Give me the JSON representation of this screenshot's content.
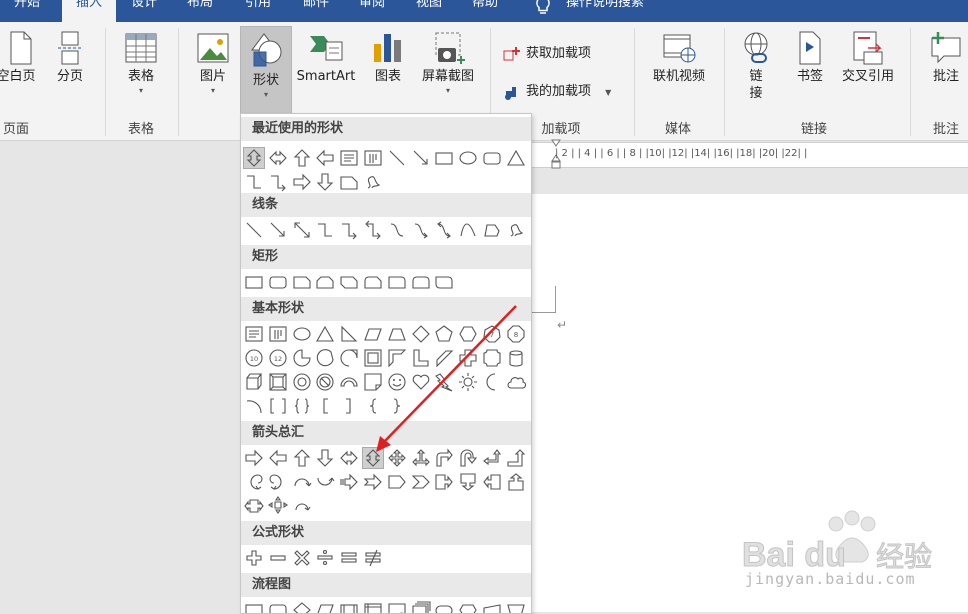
{
  "tabs": [
    "开始",
    "插入",
    "设计",
    "布局",
    "引用",
    "邮件",
    "审阅",
    "视图",
    "帮助",
    "操作说明搜索"
  ],
  "active_tab": "插入",
  "ribbon": {
    "pages": {
      "blank_page": "空白页",
      "page_break": "分页",
      "group": "页面"
    },
    "tables": {
      "table": "表格",
      "group": "表格"
    },
    "illustrations": {
      "pictures": "图片",
      "shapes": "形状",
      "smartart": "SmartArt",
      "chart": "图表",
      "screenshot": "屏幕截图"
    },
    "addins": {
      "get": "获取加载项",
      "my": "我的加载项",
      "group": "加载项"
    },
    "media": {
      "online_video": "联机视频",
      "group": "媒体"
    },
    "links": {
      "link": "链\n接",
      "bookmark": "书签",
      "cross_ref": "交叉引用",
      "group": "链接"
    },
    "comments": {
      "comment": "批注",
      "group": "批注"
    }
  },
  "ruler": "| 2 |  | 4 |  | 6 |  | 8 |  |10|  |12|  |14|  |16|  |18|  |20|  |22|  |",
  "para_mark": "↵",
  "shapes_menu": {
    "sections": [
      {
        "title": "最近使用的形状",
        "icons": [
          "up-down-arrow",
          "left-right-arrow",
          "up-arrow",
          "left-arrow",
          "text-box",
          "vertical-text-box",
          "line",
          "arrow-line",
          "rectangle",
          "oval",
          "rounded-rectangle",
          "triangle",
          "elbow-connector",
          "elbow-arrow-connector",
          "right-arrow",
          "down-arrow",
          "snip-rectangle",
          "freeform-scribble"
        ]
      },
      {
        "title": "线条",
        "icons": [
          "line",
          "arrow-line",
          "double-arrow-line",
          "elbow-connector",
          "elbow-arrow-connector",
          "elbow-double-arrow-connector",
          "curved-connector",
          "curved-arrow-connector",
          "curved-double-arrow-connector",
          "curve",
          "freeform",
          "scribble"
        ]
      },
      {
        "title": "矩形",
        "icons": [
          "rectangle",
          "rounded-rectangle",
          "snip-single-corner-rectangle",
          "snip-same-side-corner-rectangle",
          "snip-diagonal-corner-rectangle",
          "snip-round-single-corner-rectangle",
          "round-single-corner-rectangle",
          "round-same-side-corner-rectangle",
          "round-diagonal-corner-rectangle"
        ]
      },
      {
        "title": "基本形状",
        "icons": [
          "text-box",
          "vertical-text-box",
          "oval",
          "isosceles-triangle",
          "right-triangle",
          "parallelogram",
          "trapezoid",
          "diamond",
          "pentagon",
          "hexagon",
          "heptagon",
          "octagon",
          "decagon",
          "dodecagon",
          "pie",
          "chord",
          "teardrop",
          "frame",
          "half-frame",
          "l-shape",
          "diagonal-stripe",
          "cross",
          "plaque",
          "can",
          "cube",
          "bevel",
          "donut",
          "no-symbol",
          "block-arc",
          "folded-corner",
          "smiley-face",
          "heart",
          "lightning-bolt",
          "sun",
          "moon",
          "cloud",
          "arc",
          "double-bracket",
          "double-brace",
          "left-bracket",
          "right-bracket",
          "left-brace",
          "right-brace"
        ]
      },
      {
        "title": "箭头总汇",
        "icons": [
          "right-arrow",
          "left-arrow",
          "up-arrow",
          "down-arrow",
          "left-right-arrow",
          "up-down-arrow",
          "quad-arrow",
          "left-right-up-arrow",
          "bent-arrow",
          "u-turn-arrow",
          "left-up-arrow",
          "bent-up-arrow",
          "curved-right-arrow",
          "curved-left-arrow",
          "curved-up-arrow",
          "curved-down-arrow",
          "striped-right-arrow",
          "notched-right-arrow",
          "pentagon-arrow",
          "chevron-arrow",
          "right-arrow-callout",
          "down-arrow-callout",
          "left-arrow-callout",
          "up-arrow-callout",
          "left-right-arrow-callout",
          "quad-arrow-callout",
          "circular-arrow"
        ]
      },
      {
        "title": "公式形状",
        "icons": [
          "plus",
          "minus",
          "multiply",
          "division",
          "equal",
          "not-equal"
        ]
      },
      {
        "title": "流程图",
        "icons": [
          "flowchart-process",
          "flowchart-alternate-process",
          "flowchart-decision",
          "flowchart-data",
          "flowchart-predefined-process",
          "flowchart-internal-storage",
          "flowchart-document",
          "flowchart-multidocument",
          "flowchart-terminator",
          "flowchart-preparation",
          "flowchart-manual-input",
          "flowchart-manual-operation"
        ]
      }
    ],
    "selected_recent": "up-down-arrow",
    "highlighted_arrow": "up-down-arrow"
  },
  "annotation": {
    "color": "#e02020"
  },
  "watermark": {
    "text": "jingyan.baidu.com",
    "brand": "Baidu 经验"
  },
  "colors": {
    "ribbon_tabbar": "#2b579a",
    "ribbon_body": "#f3f3f3",
    "selected": "#c5c5c5"
  }
}
